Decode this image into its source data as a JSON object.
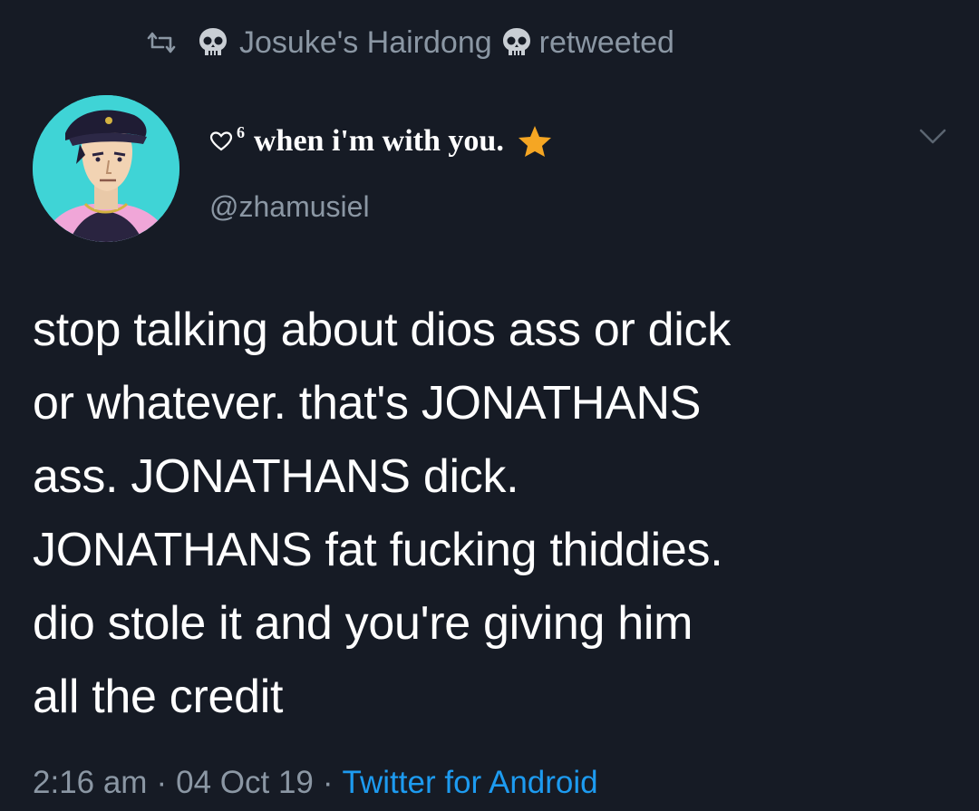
{
  "retweet": {
    "icon": "retweet-icon",
    "retweeter_name": "Josuke's Hairdong",
    "label": "retweeted"
  },
  "author": {
    "display_name": "when i'm with you.",
    "superscript": "6",
    "handle": "@zhamusiel"
  },
  "tweet": {
    "text": "stop talking about dios ass or dick\nor whatever. that's JONATHANS\nass. JONATHANS dick.\nJONATHANS fat fucking thiddies.\ndio stole it and you're giving him\nall the credit"
  },
  "meta": {
    "time": "2:16 am",
    "separator": "·",
    "date": "04 Oct 19",
    "source": "Twitter for Android"
  },
  "colors": {
    "background": "#161b25",
    "muted_text": "#8b97a4",
    "link": "#1d9bf0",
    "star": "#f5a623"
  }
}
